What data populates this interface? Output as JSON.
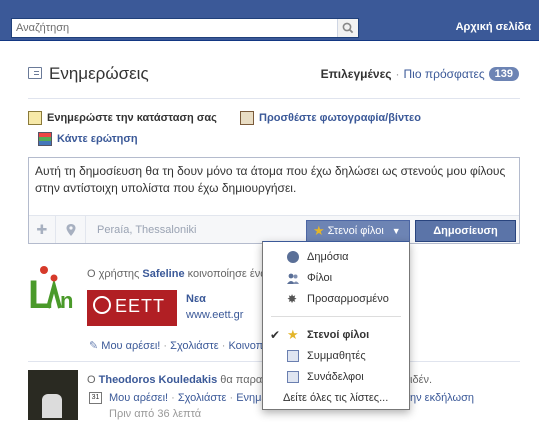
{
  "topbar": {
    "search_placeholder": "Αναζήτηση",
    "home_label": "Αρχική σελίδα",
    "bg_color": "#3b5998"
  },
  "header": {
    "title": "Ενημερώσεις",
    "selected_label": "Επιλεγμένες",
    "separator": "·",
    "recent_label": "Πιο πρόσφατες",
    "count": "139"
  },
  "composer": {
    "tab_status": "Ενημερώστε την κατάσταση σας",
    "tab_photo": "Προσθέστε φωτογραφία/βίντεο",
    "tab_question": "Κάντε ερώτηση",
    "text": "Αυτή τη δημοσίευση θα τη δουν μόνο τα άτομα που έχω δηλώσει ως στενούς μου φίλους στην αντίστοιχη υπολίστα που έχω δημιουργήσει.",
    "location": "Peraía, Thessaloniki",
    "audience_label": "Στενοί φίλοι",
    "publish_label": "Δημοσίευση"
  },
  "audience_menu": {
    "items": [
      {
        "label": "Δημόσια",
        "icon": "globe-icon"
      },
      {
        "label": "Φίλοι",
        "icon": "friends-icon"
      },
      {
        "label": "Προσαρμοσμένο",
        "icon": "gear-icon"
      }
    ],
    "lists": [
      {
        "label": "Στενοί φίλοι",
        "icon": "star-icon",
        "checked": true
      },
      {
        "label": "Συμμαθητές",
        "icon": "classmates-icon",
        "checked": false
      },
      {
        "label": "Συνάδελφοι",
        "icon": "coworkers-icon",
        "checked": false
      }
    ],
    "see_all": "Δείτε όλες τις λίστες..."
  },
  "feed": {
    "story1": {
      "prefix": "Ο χρήστης ",
      "user": "Safeline",
      "suffix": " κοινοποίησε ένα",
      "link_title": "Nεα",
      "link_url": "www.eett.gr",
      "thumb_text": "ΕΕΤΤ",
      "actions": [
        "Μου αρέσει!",
        "Σχολιάστε",
        "Κοινοπ"
      ]
    },
    "story2": {
      "prefix": "Ο ",
      "user": "Theodoros Kouledakis",
      "suffix": " θα παρακολουθήσ",
      "tail": "ιδέν.",
      "cal_text": "31",
      "actions": [
        "Μου αρέσει!",
        "Σχολιάστε",
        "Ενημε"
      ],
      "actions_tail": "ην εκδήλωση",
      "time": "Πριν από 36 λεπτά"
    }
  }
}
